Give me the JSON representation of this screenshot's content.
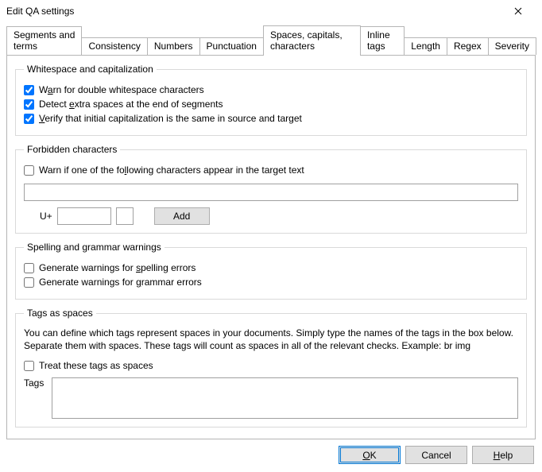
{
  "window": {
    "title": "Edit QA settings"
  },
  "tabs": [
    {
      "label": "Segments and terms"
    },
    {
      "label": "Consistency"
    },
    {
      "label": "Numbers"
    },
    {
      "label": "Punctuation"
    },
    {
      "label": "Spaces, capitals, characters",
      "active": true
    },
    {
      "label": "Inline tags"
    },
    {
      "label": "Length"
    },
    {
      "label": "Regex"
    },
    {
      "label": "Severity"
    }
  ],
  "whitespace": {
    "legend": "Whitespace and capitalization",
    "warnDouble": {
      "pre": "W",
      "u": "a",
      "post": "rn for double whitespace characters",
      "checked": true
    },
    "detectEnd": {
      "pre": "Detect ",
      "u": "e",
      "post": "xtra spaces at the end of segments",
      "checked": true
    },
    "verifyCap": {
      "pre": "",
      "u": "V",
      "post": "erify that initial capitalization is the same in source and target",
      "checked": true
    }
  },
  "forbidden": {
    "legend": "Forbidden characters",
    "warn": {
      "pre": "Warn if one of the fo",
      "u": "l",
      "post": "lowing characters appear in the target text",
      "checked": false
    },
    "textValue": "",
    "uLabel": "U+",
    "hexValue": "",
    "charValue": "",
    "addLabel": "Add"
  },
  "spelling": {
    "legend": "Spelling and grammar warnings",
    "spell": {
      "pre": "Generate warnings for ",
      "u": "s",
      "post": "pelling errors",
      "checked": false
    },
    "grammar": {
      "pre": "Generate warnings for ",
      "u": "g",
      "post": "rammar errors",
      "checked": false
    }
  },
  "tagsAsSpaces": {
    "legend": "Tags as spaces",
    "help": "You can define which tags represent spaces in your documents. Simply type the names of the tags in the box below. Separate them with spaces. These tags will count as spaces in all of the relevant checks. Example: br img",
    "treat": {
      "label": "Treat these tags as spaces",
      "checked": false
    },
    "tagsLabel": "Tags",
    "tagsValue": ""
  },
  "buttons": {
    "ok": {
      "pre": "",
      "u": "O",
      "post": "K"
    },
    "cancel": "Cancel",
    "help": {
      "pre": "",
      "u": "H",
      "post": "elp"
    }
  }
}
